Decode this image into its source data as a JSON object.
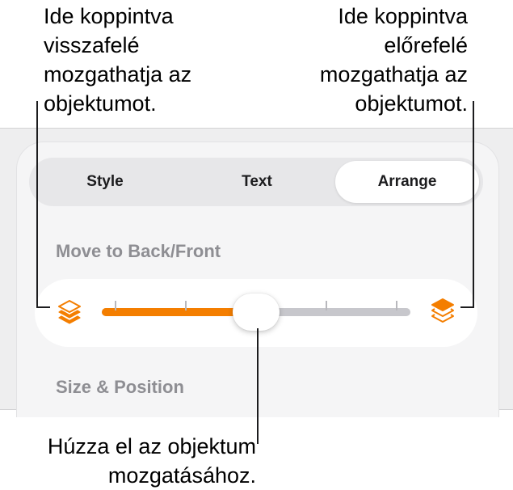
{
  "callouts": {
    "left": [
      "Ide koppintva",
      "visszafelé",
      "mozgathatja az",
      "objektumot."
    ],
    "right": [
      "Ide koppintva",
      "előrefelé",
      "mozgathatja az",
      "objektumot."
    ],
    "bottom": [
      "Húzza el az objektum",
      "mozgatásához."
    ]
  },
  "tabs": [
    {
      "label": "Style",
      "selected": false
    },
    {
      "label": "Text",
      "selected": false
    },
    {
      "label": "Arrange",
      "selected": true
    }
  ],
  "sections": {
    "move": "Move to Back/Front",
    "size": "Size & Position"
  },
  "slider": {
    "value": 0.5,
    "steps": 4,
    "fill_color": "#f47e00",
    "track_color": "#c7c7cc",
    "back_icon": "layers-back-icon",
    "front_icon": "layers-front-icon"
  },
  "colors": {
    "accent": "#f47e00",
    "panel": "#eeeeef",
    "label": "#8e8e93"
  }
}
